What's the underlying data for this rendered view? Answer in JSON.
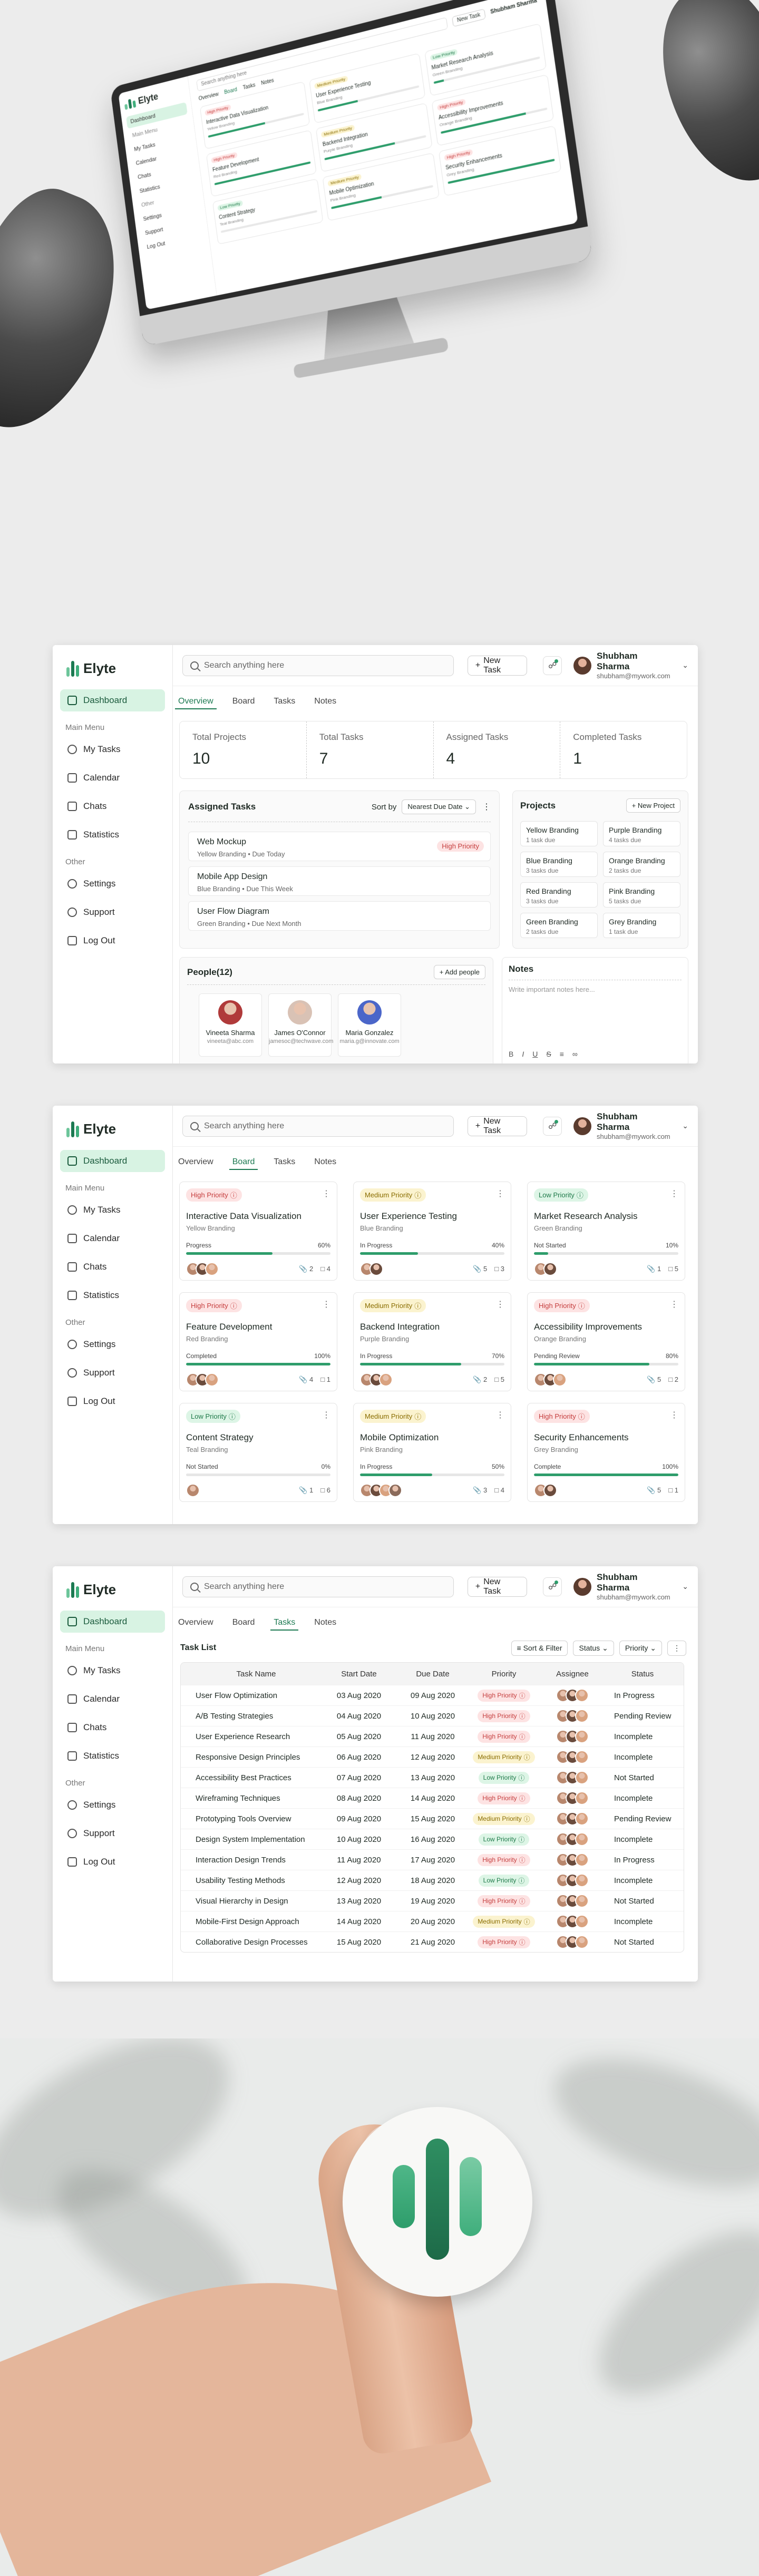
{
  "brand": {
    "name": "Elyte",
    "accent": "#2e9d6b",
    "accent_light": "#d8f3e3"
  },
  "sidebar": {
    "dashboard": "Dashboard",
    "main_menu": "Main Menu",
    "items": [
      "My Tasks",
      "Calendar",
      "Chats",
      "Statistics"
    ],
    "other": "Other",
    "other_items": [
      "Settings",
      "Support",
      "Log Out"
    ]
  },
  "topbar": {
    "search_placeholder": "Search anything here",
    "new_task": "New Task",
    "user_name": "Shubham Sharma",
    "user_email": "shubham@mywork.com"
  },
  "tabs": [
    "Overview",
    "Board",
    "Tasks",
    "Notes"
  ],
  "overview": {
    "stats": [
      {
        "label": "Total Projects",
        "value": "10"
      },
      {
        "label": "Total Tasks",
        "value": "7"
      },
      {
        "label": "Assigned Tasks",
        "value": "4"
      },
      {
        "label": "Completed Tasks",
        "value": "1"
      }
    ],
    "assigned": {
      "title": "Assigned Tasks",
      "sort_by": "Sort by",
      "sort_value": "Nearest Due Date",
      "tasks": [
        {
          "title": "Web Mockup",
          "project": "Yellow Branding",
          "due": "Due Today",
          "priority": "High Priority"
        },
        {
          "title": "Mobile App Design",
          "project": "Blue Branding",
          "due": "Due This Week"
        },
        {
          "title": "User Flow Diagram",
          "project": "Green Branding",
          "due": "Due Next Month"
        }
      ]
    },
    "projects": {
      "title": "Projects",
      "new_label": "New Project",
      "items": [
        {
          "name": "Yellow Branding",
          "meta": "1 task due"
        },
        {
          "name": "Purple Branding",
          "meta": "4 tasks due"
        },
        {
          "name": "Blue Branding",
          "meta": "3 tasks due"
        },
        {
          "name": "Orange Branding",
          "meta": "2 tasks due"
        },
        {
          "name": "Red Branding",
          "meta": "3 tasks due"
        },
        {
          "name": "Pink Branding",
          "meta": "5 tasks due"
        },
        {
          "name": "Green Branding",
          "meta": "2 tasks due"
        },
        {
          "name": "Grey Branding",
          "meta": "1 task due"
        }
      ]
    },
    "people": {
      "title": "People(12)",
      "add_label": "Add people",
      "items": [
        {
          "name": "Vineeta Sharma",
          "email": "vineeta@abc.com"
        },
        {
          "name": "James O'Connor",
          "email": "jamesoc@techwave.com"
        },
        {
          "name": "Maria Gonzalez",
          "email": "maria.g@innovate.com"
        }
      ]
    },
    "notes": {
      "title": "Notes",
      "placeholder": "Write important notes here..."
    }
  },
  "board": {
    "cards": [
      {
        "priority": "High Priority",
        "title": "Interactive Data Visualization",
        "project": "Yellow Branding",
        "status": "Progress",
        "percent": "60%",
        "progress": 60,
        "attachments": "2",
        "comments": "4",
        "people": 3
      },
      {
        "priority": "Medium Priority",
        "title": "User Experience Testing",
        "project": "Blue Branding",
        "status": "In Progress",
        "percent": "40%",
        "progress": 40,
        "attachments": "5",
        "comments": "3",
        "people": 2
      },
      {
        "priority": "Low Priority",
        "title": "Market Research Analysis",
        "project": "Green Branding",
        "status": "Not Started",
        "percent": "10%",
        "progress": 10,
        "attachments": "1",
        "comments": "5",
        "people": 2
      },
      {
        "priority": "High Priority",
        "title": "Feature Development",
        "project": "Red Branding",
        "status": "Completed",
        "percent": "100%",
        "progress": 100,
        "attachments": "4",
        "comments": "1",
        "people": 3
      },
      {
        "priority": "Medium Priority",
        "title": "Backend Integration",
        "project": "Purple Branding",
        "status": "In Progress",
        "percent": "70%",
        "progress": 70,
        "attachments": "2",
        "comments": "5",
        "people": 3
      },
      {
        "priority": "High Priority",
        "title": "Accessibility Improvements",
        "project": "Orange Branding",
        "status": "Pending Review",
        "percent": "80%",
        "progress": 80,
        "attachments": "5",
        "comments": "2",
        "people": 3
      },
      {
        "priority": "Low Priority",
        "title": "Content Strategy",
        "project": "Teal Branding",
        "status": "Not Started",
        "percent": "0%",
        "progress": 0,
        "attachments": "1",
        "comments": "6",
        "people": 1
      },
      {
        "priority": "Medium Priority",
        "title": "Mobile Optimization",
        "project": "Pink Branding",
        "status": "In Progress",
        "percent": "50%",
        "progress": 50,
        "attachments": "3",
        "comments": "4",
        "people": 4
      },
      {
        "priority": "High Priority",
        "title": "Security Enhancements",
        "project": "Grey Branding",
        "status": "Complete",
        "percent": "100%",
        "progress": 100,
        "attachments": "5",
        "comments": "1",
        "people": 2
      }
    ]
  },
  "tasks": {
    "title": "Task List",
    "filter_label": "Sort & Filter",
    "status_label": "Status",
    "priority_label": "Priority",
    "columns": [
      "Task Name",
      "Start Date",
      "Due Date",
      "Priority",
      "Assignee",
      "Status"
    ],
    "rows": [
      {
        "name": "User Flow Optimization",
        "start": "03 Aug 2020",
        "due": "09 Aug 2020",
        "priority": "High Priority",
        "status": "In Progress"
      },
      {
        "name": "A/B Testing Strategies",
        "start": "04 Aug 2020",
        "due": "10 Aug 2020",
        "priority": "High Priority",
        "status": "Pending Review"
      },
      {
        "name": "User Experience Research",
        "start": "05 Aug 2020",
        "due": "11 Aug 2020",
        "priority": "High Priority",
        "status": "Incomplete"
      },
      {
        "name": "Responsive Design Principles",
        "start": "06 Aug 2020",
        "due": "12 Aug 2020",
        "priority": "Medium Priority",
        "status": "Incomplete"
      },
      {
        "name": "Accessibility Best Practices",
        "start": "07 Aug 2020",
        "due": "13 Aug 2020",
        "priority": "Low Priority",
        "status": "Not Started"
      },
      {
        "name": "Wireframing Techniques",
        "start": "08 Aug 2020",
        "due": "14 Aug 2020",
        "priority": "High Priority",
        "status": "Incomplete"
      },
      {
        "name": "Prototyping Tools Overview",
        "start": "09 Aug 2020",
        "due": "15 Aug 2020",
        "priority": "Medium Priority",
        "status": "Pending Review"
      },
      {
        "name": "Design System Implementation",
        "start": "10 Aug 2020",
        "due": "16 Aug 2020",
        "priority": "Low Priority",
        "status": "Incomplete"
      },
      {
        "name": "Interaction Design Trends",
        "start": "11 Aug 2020",
        "due": "17 Aug 2020",
        "priority": "High Priority",
        "status": "In Progress"
      },
      {
        "name": "Usability Testing Methods",
        "start": "12 Aug 2020",
        "due": "18 Aug 2020",
        "priority": "Low Priority",
        "status": "Incomplete"
      },
      {
        "name": "Visual Hierarchy in Design",
        "start": "13 Aug 2020",
        "due": "19 Aug 2020",
        "priority": "High Priority",
        "status": "Not Started"
      },
      {
        "name": "Mobile-First Design Approach",
        "start": "14 Aug 2020",
        "due": "20 Aug 2020",
        "priority": "Medium Priority",
        "status": "Incomplete"
      },
      {
        "name": "Collaborative Design Processes",
        "start": "15 Aug 2020",
        "due": "21 Aug 2020",
        "priority": "High Priority",
        "status": "Not Started"
      }
    ]
  }
}
